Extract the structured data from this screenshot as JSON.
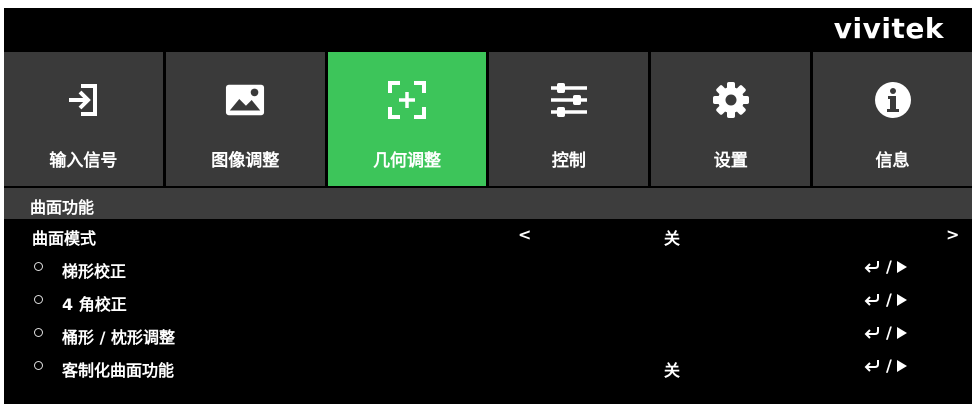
{
  "brand": "vivitek",
  "tabs": [
    {
      "label": "输入信号",
      "icon": "input-icon",
      "active": false
    },
    {
      "label": "图像调整",
      "icon": "image-icon",
      "active": false
    },
    {
      "label": "几何调整",
      "icon": "geometry-icon",
      "active": true
    },
    {
      "label": "控制",
      "icon": "sliders-icon",
      "active": false
    },
    {
      "label": "设置",
      "icon": "gear-icon",
      "active": false
    },
    {
      "label": "信息",
      "icon": "info-icon",
      "active": false
    }
  ],
  "section_title": "曲面功能",
  "rows": [
    {
      "label": "曲面模式",
      "value": "关",
      "prev": "<",
      "next": ">"
    },
    {
      "label": "梯形校正",
      "action_sep": "/"
    },
    {
      "label": "4 角校正",
      "action_sep": "/"
    },
    {
      "label": "桶形 / 枕形调整",
      "action_sep": "/"
    },
    {
      "label": "客制化曲面功能",
      "value": "关",
      "action_sep": "/"
    }
  ],
  "colors": {
    "active_tab": "#3dc55a",
    "tab_bg": "#3a3a3a",
    "section_bg": "#3d3d3d",
    "panel_bg": "#000000"
  }
}
